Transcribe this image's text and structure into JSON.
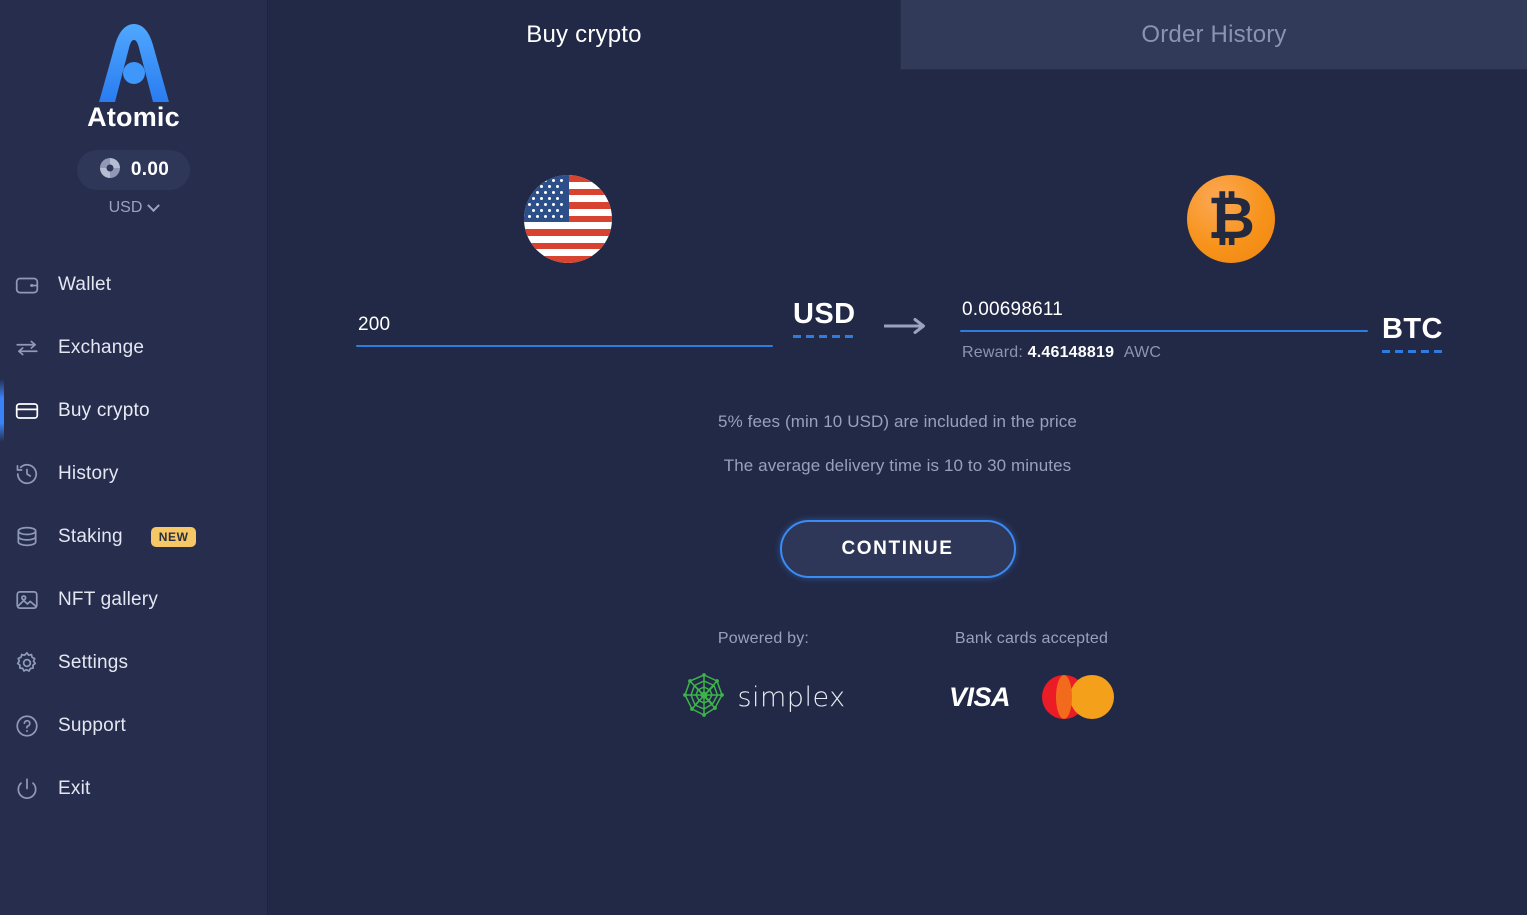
{
  "sidebar": {
    "brand_name": "Atomic",
    "logo_icon": "atomic-a-logo",
    "balance": {
      "icon": "donut-chart-icon",
      "amount": "0.00",
      "currency": "USD",
      "chevron_icon": "chevron-down-icon"
    },
    "items": [
      {
        "label": "Wallet",
        "icon": "wallet-icon",
        "active": false,
        "badge": null
      },
      {
        "label": "Exchange",
        "icon": "exchange-icon",
        "active": false,
        "badge": null
      },
      {
        "label": "Buy crypto",
        "icon": "card-icon",
        "active": true,
        "badge": null
      },
      {
        "label": "History",
        "icon": "clock-icon",
        "active": false,
        "badge": null
      },
      {
        "label": "Staking",
        "icon": "stack-icon",
        "active": false,
        "badge": "NEW"
      },
      {
        "label": "NFT gallery",
        "icon": "image-icon",
        "active": false,
        "badge": null
      },
      {
        "label": "Settings",
        "icon": "gear-icon",
        "active": false,
        "badge": null
      },
      {
        "label": "Support",
        "icon": "question-icon",
        "active": false,
        "badge": null
      },
      {
        "label": "Exit",
        "icon": "power-icon",
        "active": false,
        "badge": null
      }
    ]
  },
  "tabs": {
    "buy_crypto": "Buy crypto",
    "order_history": "Order History"
  },
  "convert": {
    "from": {
      "coin_icon": "usa-flag-icon",
      "amount": "200",
      "placeholder": "0",
      "ticker": "USD"
    },
    "arrow_icon": "arrow-right-icon",
    "to": {
      "coin_icon": "bitcoin-icon",
      "amount": "0.00698611",
      "placeholder": "0",
      "ticker": "BTC"
    },
    "reward": {
      "label": "Reward:",
      "value": "4.46148819",
      "unit": "AWC"
    }
  },
  "notes": [
    "5% fees (min 10 USD) are included in the price",
    "The average delivery time is 10 to 30 minutes"
  ],
  "cta": {
    "label": "CONTINUE"
  },
  "footer": {
    "powered_by_title": "Powered by:",
    "provider_name": "simplex",
    "provider_icon": "simplex-logo",
    "bank_cards_title": "Bank cards accepted",
    "cards": [
      {
        "name": "VISA",
        "icon": "visa-logo"
      },
      {
        "name": "Mastercard",
        "icon": "mastercard-logo"
      }
    ]
  },
  "colors": {
    "background": "#222946",
    "sidebar": "#262d4d",
    "tab_inactive_bg": "#313b59",
    "accent_blue": "#3a8bf5",
    "underline_blue": "#2f7ce0",
    "badge_amber": "#f6c765",
    "bitcoin_orange": "#f7931a",
    "simplex_green": "#3cb44a",
    "mastercard_red": "#eb1c26",
    "mastercard_amber": "#f5a01b",
    "muted_text": "#97a0bc"
  }
}
